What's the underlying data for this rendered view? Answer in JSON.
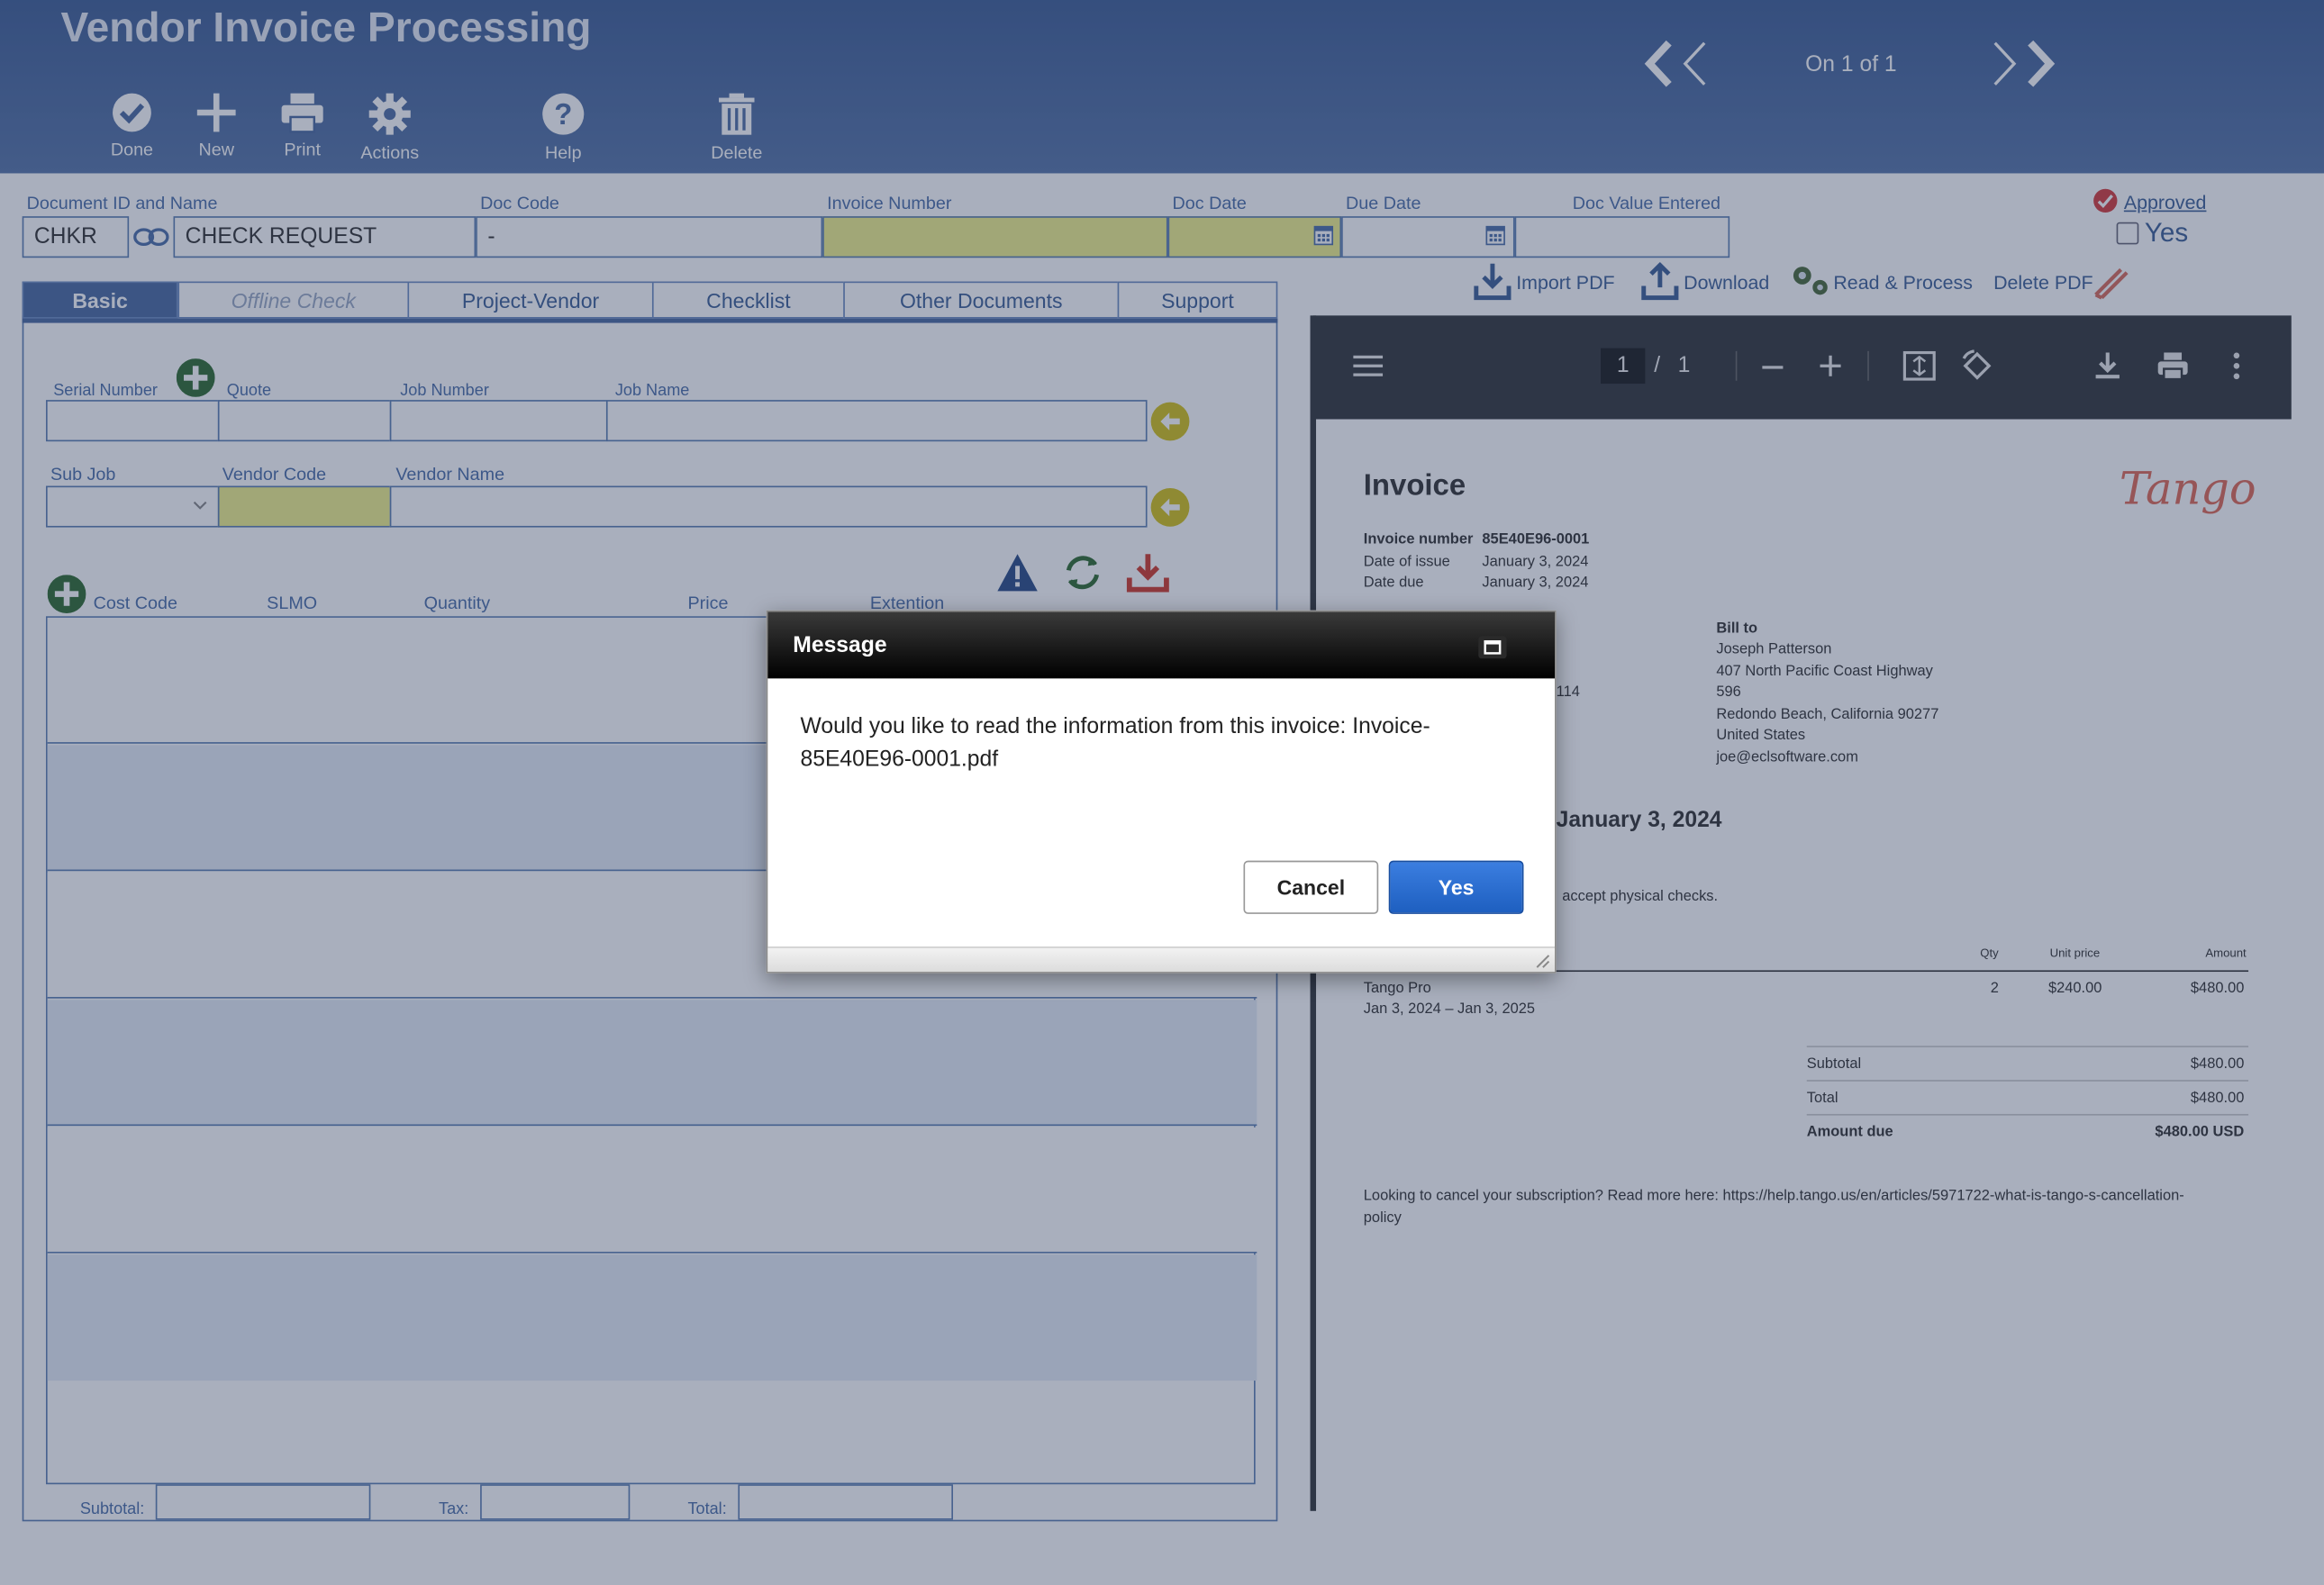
{
  "app": {
    "title": "Vendor Invoice Processing"
  },
  "toolbar": {
    "done": "Done",
    "new": "New",
    "print": "Print",
    "actions": "Actions",
    "help": "Help",
    "delete": "Delete"
  },
  "pager": {
    "text": "On 1 of 1"
  },
  "header_fields": {
    "doc_id_label": "Document ID and Name",
    "doc_id_value": "CHKR",
    "doc_name_value": "CHECK REQUEST",
    "doc_code_label": "Doc Code",
    "doc_code_value": "-",
    "invoice_number_label": "Invoice Number",
    "invoice_number_value": "",
    "doc_date_label": "Doc Date",
    "doc_date_value": "",
    "due_date_label": "Due Date",
    "due_date_value": "",
    "doc_value_label": "Doc Value Entered",
    "doc_value_value": "",
    "approved_label": "Approved",
    "approved_value": "Yes"
  },
  "pdf_actions": {
    "import": "Import PDF",
    "download": "Download",
    "read": "Read & Process",
    "delete": "Delete PDF"
  },
  "tabs": [
    "Basic",
    "Offline Check",
    "Project-Vendor",
    "Checklist",
    "Other Documents",
    "Support"
  ],
  "basic": {
    "serial_label": "Serial Number",
    "quote_label": "Quote",
    "job_number_label": "Job Number",
    "job_name_label": "Job Name",
    "sub_job_label": "Sub Job",
    "vendor_code_label": "Vendor Code",
    "vendor_name_label": "Vendor Name"
  },
  "lines": {
    "cost_code": "Cost Code",
    "slmo": "SLMO",
    "quantity": "Quantity",
    "price": "Price",
    "extension": "Extention"
  },
  "totals": {
    "subtotal": "Subtotal:",
    "tax": "Tax:",
    "total": "Total:"
  },
  "pdf_viewer": {
    "page_current": "1",
    "page_sep": "/",
    "page_total": "1"
  },
  "invoice": {
    "title": "Invoice",
    "brand": "Tango",
    "meta": [
      {
        "label": "Invoice number",
        "value": "85E40E96-0001"
      },
      {
        "label": "Date of issue",
        "value": "January 3, 2024"
      },
      {
        "label": "Date due",
        "value": "January 3, 2024"
      }
    ],
    "bill_to_label": "Bill to",
    "bill_to": [
      "Joseph Patterson",
      "407 North Pacific Coast Highway",
      "596",
      "Redondo Beach, California 90277",
      "United States",
      "joe@eclsoftware.com"
    ],
    "partial_from": "114",
    "due_heading": "January 3, 2024",
    "checks_note": "accept physical checks.",
    "table_headers": {
      "qty": "Qty",
      "unit_price": "Unit price",
      "amount": "Amount"
    },
    "item": {
      "name": "Tango Pro",
      "period": "Jan 3, 2024 – Jan 3, 2025",
      "qty": "2",
      "unit_price": "$240.00",
      "amount": "$480.00"
    },
    "summary": [
      {
        "label": "Subtotal",
        "value": "$480.00"
      },
      {
        "label": "Total",
        "value": "$480.00"
      },
      {
        "label": "Amount due",
        "value": "$480.00 USD"
      }
    ],
    "footer_note_1": "Looking to cancel your subscription? Read more here: https://help.tango.us/en/articles/5971722-what-is-tango-s-cancellation-",
    "footer_note_2": "policy"
  },
  "dialog": {
    "title": "Message",
    "message": "Would you like to read the information from this invoice: Invoice-85E40E96-0001.pdf",
    "cancel": "Cancel",
    "yes": "Yes"
  },
  "colors": {
    "header": "#4a6aa0",
    "accent": "#2f6fd0",
    "highlight": "#f2f28a",
    "dialog_head": "#111111"
  }
}
